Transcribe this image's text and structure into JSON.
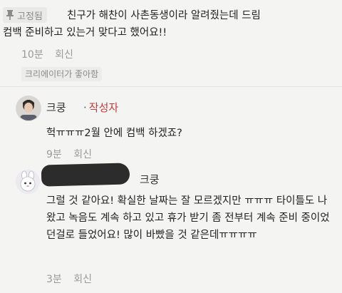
{
  "comment": {
    "pinned_label": "고정됨",
    "text_line1": "친구가 해찬이 사촌동생이라 알려줬는데 드림",
    "text_line2": "컴백 준비하고 있는거 맞다고 했어요!!",
    "time": "10분",
    "reply_label": "회신",
    "creator_liked": "크리에이터가 좋아함"
  },
  "replies": [
    {
      "author": "크쿵",
      "separator": "·",
      "creator_tag": "작성자",
      "text": "헉ㅠㅠㅠ2월 안에 컴백 하겠죠?",
      "time": "9분",
      "reply_label": "회신"
    },
    {
      "author": "크쿵",
      "text": "그럴 것 같아요! 확실한 날짜는 잘 모르겠지만 ㅠㅠㅠ 타이틀도 나왔고 녹음도 계속 하고 있고 휴가 받기 좀 전부터 계속 준비 중이었던걸로 들었어요! 많이 바빴을 것 같은데ㅠㅠㅠㅠ",
      "time": "3분",
      "reply_label": "회신"
    }
  ],
  "colors": {
    "creator_tag": "#c33c3c",
    "muted": "#9a9a9a",
    "background": "#f4f4f2"
  },
  "icons": [
    "pin-icon"
  ]
}
